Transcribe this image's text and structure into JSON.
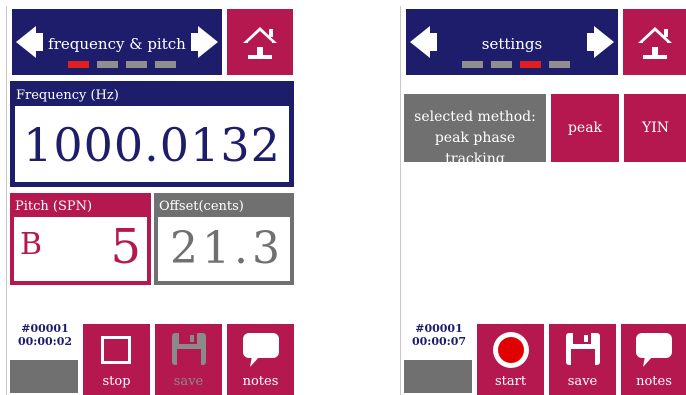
{
  "left": {
    "header": {
      "title": "frequency & pitch",
      "dots_active_index": 0
    },
    "frequency": {
      "label": "Frequency (Hz)",
      "value": "1000.0132"
    },
    "pitch": {
      "label": "Pitch (SPN)",
      "note": "B",
      "octave": "5"
    },
    "offset": {
      "label": "Offset(cents)",
      "value": "21.3"
    },
    "status": {
      "counter": "#00001",
      "time": "00:00:02"
    },
    "buttons": {
      "stop": "stop",
      "save": "save",
      "notes": "notes"
    },
    "icons": [
      "arrow-left-icon",
      "arrow-right-icon",
      "home-icon",
      "stop-icon",
      "floppy-icon",
      "speech-bubble-icon"
    ]
  },
  "right": {
    "header": {
      "title": "settings",
      "dots_active_index": 2
    },
    "method": {
      "line1": "selected method:",
      "line2": "peak phase tracking"
    },
    "options": {
      "peak": "peak",
      "yin": "YIN"
    },
    "status": {
      "counter": "#00001",
      "time": "00:00:07"
    },
    "buttons": {
      "start": "start",
      "save": "save",
      "notes": "notes"
    },
    "icons": [
      "arrow-left-icon",
      "arrow-right-icon",
      "home-icon",
      "record-icon",
      "floppy-icon",
      "speech-bubble-icon"
    ]
  },
  "colors": {
    "navy": "#1d1d6b",
    "maroon": "#b5174f",
    "grey": "#707070",
    "active_dot": "#e02020"
  }
}
